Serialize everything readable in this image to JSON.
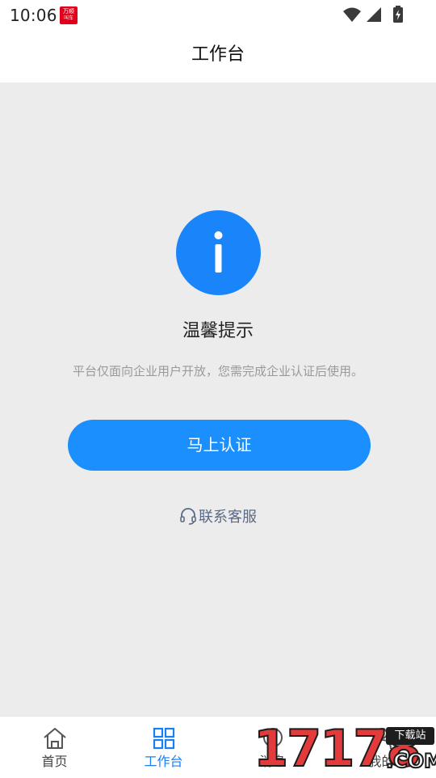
{
  "status_bar": {
    "time": "10:06",
    "app_badge_top": "万顺",
    "app_badge_bottom": "叫车"
  },
  "header": {
    "title": "工作台"
  },
  "notice": {
    "icon": "info-icon",
    "title": "温馨提示",
    "description": "平台仅面向企业用户开放，您需完成企业认证后使用。",
    "primary_button": "马上认证",
    "contact_link": "联系客服"
  },
  "tab_bar": {
    "tabs": [
      {
        "label": "首页",
        "icon": "home-icon",
        "active": false
      },
      {
        "label": "工作台",
        "icon": "grid-icon",
        "active": true
      },
      {
        "label": "消息",
        "icon": "message-icon",
        "active": false
      },
      {
        "label": "我的",
        "icon": "user-icon",
        "active": false
      }
    ]
  },
  "watermark": {
    "digits": "17178",
    "tag": "下载站",
    "suffix": ".COM"
  },
  "colors": {
    "primary": "#1a8ffd",
    "active_tab": "#1a7ff0",
    "background": "#ececec",
    "muted_text": "#9a9a9a",
    "link_text": "#5a6a85",
    "badge_red": "#e0001b"
  }
}
